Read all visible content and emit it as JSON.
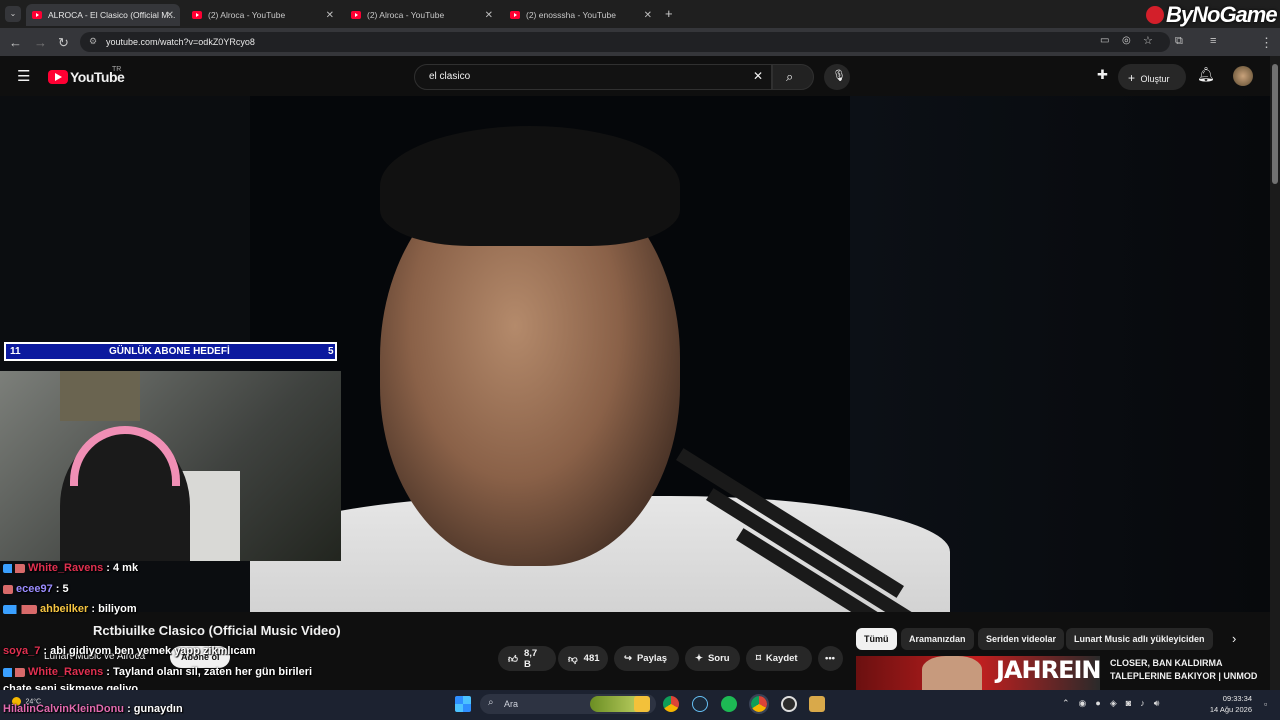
{
  "browser": {
    "tabs": [
      {
        "title": "ALROCA - El Clasico (Official M...",
        "active": true
      },
      {
        "title": "(2) Alroca - YouTube",
        "active": false
      },
      {
        "title": "(2) Alroca - YouTube",
        "active": false
      },
      {
        "title": "(2) enosssha - YouTube",
        "active": false
      }
    ],
    "url": "youtube.com/watch?v=odkZ0YRcyo8"
  },
  "youtube": {
    "logo_text": "YouTube",
    "region": "TR",
    "search_value": "el clasico",
    "create_label": "Oluştur"
  },
  "overlay": {
    "goal_left": "11",
    "goal_label": "GÜNLÜK ABONE HEDEFİ",
    "goal_right": "5",
    "brand": "ByNoGame"
  },
  "chat": [
    {
      "user": "White_Ravens",
      "text": "4 mk"
    },
    {
      "user": "ecee97",
      "text": "5"
    },
    {
      "user": "ahbeilker",
      "text": "biliyom"
    },
    {
      "user": "soya_7",
      "text": "abi gidiyom ben yemek yapp zikmlıcam"
    },
    {
      "user": "White_Ravens",
      "text": "Tayland olanı sil, zaten her gün birileri"
    },
    {
      "user": "",
      "text": "chate seni sikmeye geliyo"
    },
    {
      "user": "HilalinCalvinKleinDonu",
      "text": "gunaydın"
    }
  ],
  "video": {
    "title": "Rctbiuilke Clasico (Official Music Video)",
    "channel": "Lunart Music ve Alroca",
    "subscribe": "Abone ol",
    "likes": "8,7 B",
    "dislikes": "481",
    "share": "Paylaş",
    "ask": "Soru",
    "save": "Kaydet"
  },
  "chips": [
    "Tümü",
    "Aramanızdan",
    "Seriden videolar",
    "Lunart Music adlı yükleyiciden"
  ],
  "recommendation": {
    "thumb_text": "JAHREIN",
    "title": "CLOSER, BAN KALDIRMA TALEPLERINE BAKIYOR | UNMOD"
  },
  "taskbar": {
    "search_placeholder": "Ara",
    "weather": "24°C",
    "time": "09:33:34",
    "date": "14 Ağu 2026"
  },
  "colors": {
    "accent": "#ff0033",
    "goal_bg": "#0c1a9e"
  }
}
